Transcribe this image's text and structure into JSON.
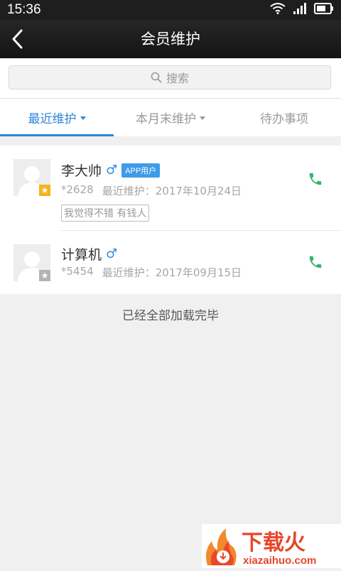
{
  "status_bar": {
    "time": "15:36"
  },
  "header": {
    "title": "会员维护"
  },
  "search": {
    "label": "搜索"
  },
  "tabs": [
    {
      "label": "最近维护",
      "active": true
    },
    {
      "label": "本月末维护",
      "active": false
    },
    {
      "label": "待办事项",
      "active": false
    }
  ],
  "customers": [
    {
      "name": "李大帅",
      "gender_symbol": "♂",
      "app_tag": "APP用户",
      "phone_tail": "*2628",
      "last_label": "最近维护：",
      "last_date": "2017年10月24日",
      "note": "我觉得不错 有钱人",
      "badge": "gold"
    },
    {
      "name": "计算机",
      "gender_symbol": "♂",
      "phone_tail": "*5454",
      "last_label": "最近维护：",
      "last_date": "2017年09月15日",
      "badge": "gray"
    }
  ],
  "footer": {
    "text": "已经全部加载完毕"
  },
  "watermark": {
    "brand": "下载火",
    "domain": "xiazaihuo.com"
  },
  "colors": {
    "accent": "#2e86d8",
    "phone": "#35b56a",
    "gold": "#f3b51c"
  }
}
